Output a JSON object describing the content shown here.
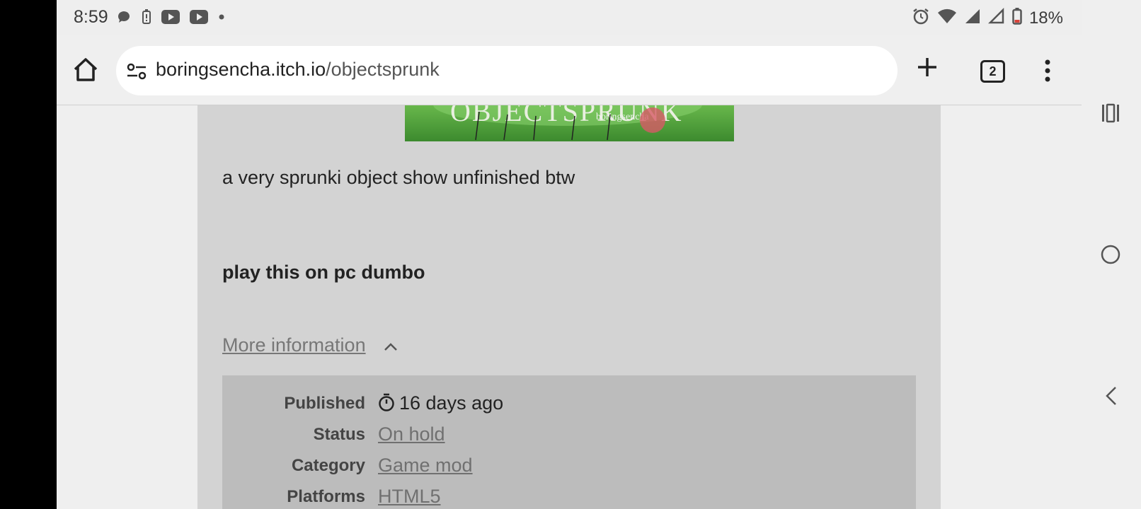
{
  "status_bar": {
    "time": "8:59",
    "battery": "18%",
    "left_icons": [
      "chat-icon",
      "battery-alert-icon",
      "youtube-icon",
      "youtube-icon",
      "dot-icon"
    ],
    "right_icons": [
      "alarm-icon",
      "wifi-icon",
      "signal-icon",
      "signal-empty-icon",
      "battery-icon"
    ]
  },
  "browser": {
    "url_domain": "boringsencha.itch.io",
    "url_path": "/objectsprunk",
    "tab_count": "2"
  },
  "page": {
    "banner_title": "OBJECTSPRUNK",
    "banner_subtitle": "boringsencha",
    "description": "a very sprunki object show unfinished btw",
    "note": "play this on pc dumbo",
    "more_info": "More information",
    "info": [
      {
        "label": "Published",
        "value": "16 days ago"
      },
      {
        "label": "Status",
        "value": "On hold"
      },
      {
        "label": "Category",
        "value": "Game mod"
      },
      {
        "label": "Platforms",
        "value": "HTML5"
      }
    ]
  },
  "colors": {
    "card_bg": "#d3d3d3",
    "info_bg": "#bcbcbc",
    "banner_green": "#4fa23a"
  }
}
